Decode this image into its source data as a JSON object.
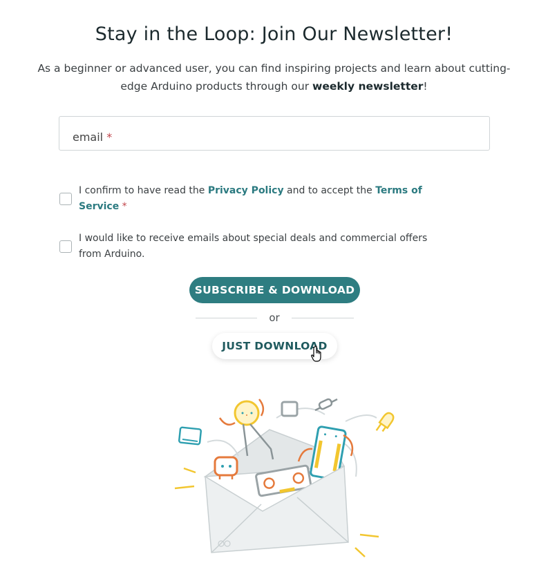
{
  "newsletter": {
    "title": "Stay in the Loop: Join Our Newsletter!",
    "intro_pre": "As a beginner or advanced user, you can find inspiring projects and learn about cutting-edge Arduino products through our ",
    "intro_bold": "weekly newsletter",
    "intro_post": "!"
  },
  "form": {
    "email_label": "email",
    "required_mark": "*",
    "consent1_pre": "I confirm to have read the ",
    "privacy_link": "Privacy Policy",
    "consent1_mid": " and to accept the ",
    "terms_link": "Terms of Service",
    "consent2": "I would like to receive emails about special deals and commercial offers from Arduino.",
    "subscribe_label": "SUBSCRIBE & DOWNLOAD",
    "or_label": "or",
    "download_label": "JUST DOWNLOAD"
  },
  "colors": {
    "primary": "#2e7d81",
    "link": "#2b7a80",
    "required": "#c1454b",
    "accent_orange": "#e57a3c",
    "accent_yellow": "#f2c62f"
  },
  "icons": {
    "cursor": "hand-pointer-icon",
    "illustration": "envelope-with-arduino-parts"
  }
}
